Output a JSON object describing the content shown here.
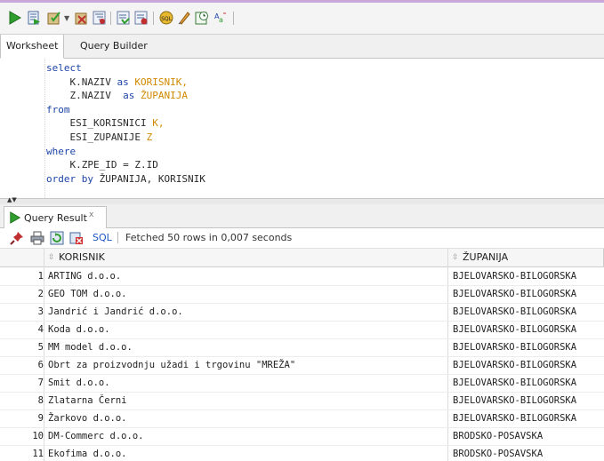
{
  "colors": {
    "run": "#2f9e2f",
    "keyword": "#1f45a8",
    "alias": "#d08a00",
    "link": "#1f56c3"
  },
  "toolbar": {
    "icons": [
      "run-statement-icon",
      "run-script-icon",
      "commit-icon",
      "dropdown-icon",
      "rollback-icon",
      "explain-plan-icon",
      "autotrace-icon",
      "sql-tuning-icon",
      "unshared-sql-icon",
      "clear-icon",
      "history-icon",
      "format-icon"
    ]
  },
  "tabs": {
    "worksheet": "Worksheet",
    "query_builder": "Query Builder"
  },
  "sql": {
    "l1": "select",
    "l2_a": "K.NAZIV",
    "l2_b": "as",
    "l2_c": "KORISNIK,",
    "l3_a": "Z.NAZIV",
    "l3_b": "as",
    "l3_c": "ŽUPANIJA",
    "l4": "from",
    "l5_a": "ESI_KORISNICI",
    "l5_b": "K,",
    "l6_a": "ESI_ZUPANIJE",
    "l6_b": "Z",
    "l7": "where",
    "l8": "K.ZPE_ID = Z.ID",
    "l9_a": "order by",
    "l9_b": "ŽUPANIJA, KORISNIK"
  },
  "result": {
    "tab_label": "Query Result",
    "close": "x",
    "sql_link": "SQL",
    "status": "Fetched 50 rows in 0,007 seconds",
    "columns": [
      "KORISNIK",
      "ŽUPANIJA"
    ],
    "rows": [
      {
        "n": "1",
        "korisnik": "ARTING d.o.o.",
        "zupanija": "BJELOVARSKO-BILOGORSKA"
      },
      {
        "n": "2",
        "korisnik": "GEO TOM d.o.o.",
        "zupanija": "BJELOVARSKO-BILOGORSKA"
      },
      {
        "n": "3",
        "korisnik": "Jandrić i Jandrić d.o.o.",
        "zupanija": "BJELOVARSKO-BILOGORSKA"
      },
      {
        "n": "4",
        "korisnik": "Koda d.o.o.",
        "zupanija": "BJELOVARSKO-BILOGORSKA"
      },
      {
        "n": "5",
        "korisnik": "MM model d.o.o.",
        "zupanija": "BJELOVARSKO-BILOGORSKA"
      },
      {
        "n": "6",
        "korisnik": "Obrt za proizvodnju užadi i trgovinu \"MREŽA\"",
        "zupanija": "BJELOVARSKO-BILOGORSKA"
      },
      {
        "n": "7",
        "korisnik": "Smit d.o.o.",
        "zupanija": "BJELOVARSKO-BILOGORSKA"
      },
      {
        "n": "8",
        "korisnik": "Zlatarna Černi",
        "zupanija": "BJELOVARSKO-BILOGORSKA"
      },
      {
        "n": "9",
        "korisnik": "Žarkovo d.o.o.",
        "zupanija": "BJELOVARSKO-BILOGORSKA"
      },
      {
        "n": "10",
        "korisnik": "DM-Commerc d.o.o.",
        "zupanija": "BRODSKO-POSAVSKA"
      },
      {
        "n": "11",
        "korisnik": "Ekofima d.o.o.",
        "zupanija": "BRODSKO-POSAVSKA"
      }
    ]
  }
}
